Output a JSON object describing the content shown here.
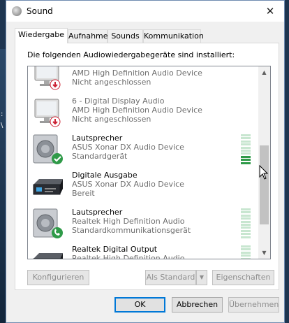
{
  "window": {
    "title": "Sound",
    "close_glyph": "✕"
  },
  "tabs": [
    {
      "label": "Wiedergabe",
      "active": true
    },
    {
      "label": "Aufnahme",
      "active": false
    },
    {
      "label": "Sounds",
      "active": false
    },
    {
      "label": "Kommunikation",
      "active": false
    }
  ],
  "panel": {
    "instructions": "Die folgenden Audiowiedergabegeräte sind installiert:"
  },
  "devices": [
    {
      "name": "",
      "driver": "AMD High Definition Audio Device",
      "status": "Nicht angeschlossen",
      "icon": "monitor-icon",
      "badge": "red-down-arrow"
    },
    {
      "name": "6 - Digital Display Audio",
      "driver": "AMD High Definition Audio Device",
      "status": "Nicht angeschlossen",
      "icon": "monitor-icon",
      "badge": "red-down-arrow"
    },
    {
      "name": "Lautsprecher",
      "driver": "ASUS Xonar DX Audio Device",
      "status": "Standardgerät",
      "icon": "speaker-icon",
      "badge": "green-check",
      "level": 0.25
    },
    {
      "name": "Digitale Ausgabe",
      "driver": "ASUS Xonar DX Audio Device",
      "status": "Bereit",
      "icon": "digital-output-icon",
      "badge": "none"
    },
    {
      "name": "Lautsprecher",
      "driver": "Realtek High Definition Audio",
      "status": "Standardkommunikationsgerät",
      "icon": "speaker-icon",
      "badge": "green-phone",
      "level": 0
    },
    {
      "name": "Realtek Digital Output",
      "driver": "Realtek High Definition Audio",
      "status": "",
      "icon": "digital-output-icon",
      "badge": "none",
      "level": 0
    }
  ],
  "scrollbar": {
    "up_glyph": "▲",
    "down_glyph": "▼"
  },
  "panel_buttons": {
    "configure": "Konfigurieren",
    "set_default": "Als Standard",
    "set_default_arrow": "▼",
    "properties": "Eigenschaften"
  },
  "dialog_buttons": {
    "ok": "OK",
    "cancel": "Abbrechen",
    "apply": "Übernehmen"
  },
  "colors": {
    "accent": "#0078d7",
    "meter_on": "#2f9a48",
    "meter_off": "#c8e6d0",
    "disabled_text": "#8e8e8e"
  }
}
